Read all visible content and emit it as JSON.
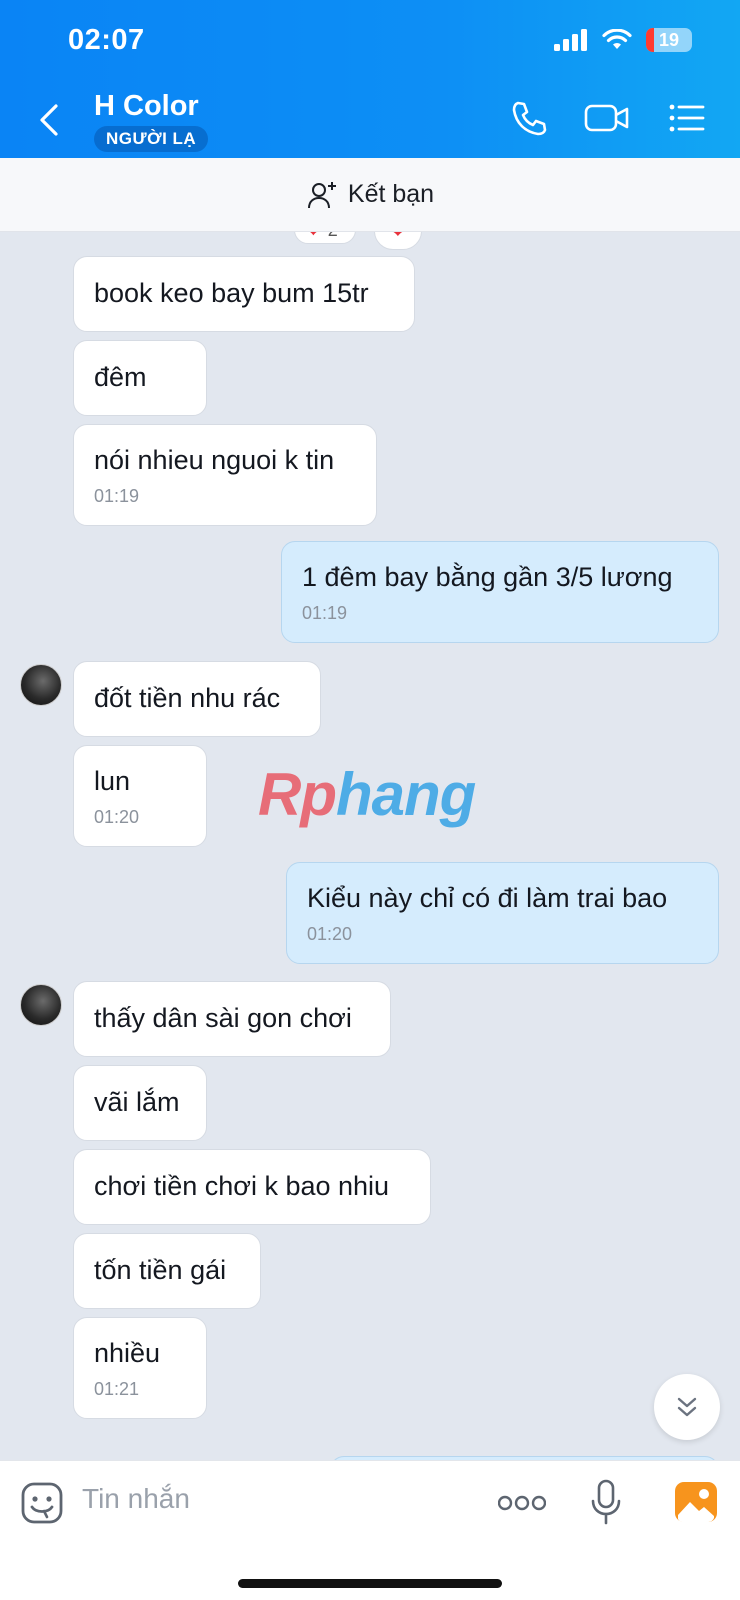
{
  "status_bar": {
    "time": "02:07",
    "battery": "19"
  },
  "header": {
    "contact_name": "H Color",
    "badge": "NGƯỜI LẠ"
  },
  "friend_bar": {
    "label": "Kết bạn"
  },
  "reactions": {
    "heart_count": "2"
  },
  "messages": [
    {
      "side": "them",
      "text": "book keo bay bum 15tr",
      "time": ""
    },
    {
      "side": "them",
      "text": "đêm",
      "time": ""
    },
    {
      "side": "them",
      "text": "nói nhieu nguoi k tin",
      "time": "01:19"
    },
    {
      "side": "me",
      "text": "1 đêm bay bằng gần 3/5 lương",
      "time": "01:19"
    },
    {
      "side": "them",
      "text": "đốt tiền nhu rác",
      "time": ""
    },
    {
      "side": "them",
      "text": "lun",
      "time": "01:20"
    },
    {
      "side": "me",
      "text": "Kiểu này chỉ có đi làm trai bao",
      "time": "01:20"
    },
    {
      "side": "them",
      "text": "thấy dân sài gon chơi",
      "time": ""
    },
    {
      "side": "them",
      "text": "vãi lắm",
      "time": ""
    },
    {
      "side": "them",
      "text": "chơi tiền chơi k bao nhiu",
      "time": ""
    },
    {
      "side": "them",
      "text": "tốn tiền gái",
      "time": ""
    },
    {
      "side": "them",
      "text": "nhiều",
      "time": "01:21"
    }
  ],
  "watermark": {
    "part1": "Rp",
    "part2": "hang"
  },
  "input": {
    "placeholder": "Tin nhắn"
  },
  "colors": {
    "header": "#0a84f5",
    "my_bubble": "#d5ecfd",
    "chat_bg": "#e2e7ef"
  }
}
